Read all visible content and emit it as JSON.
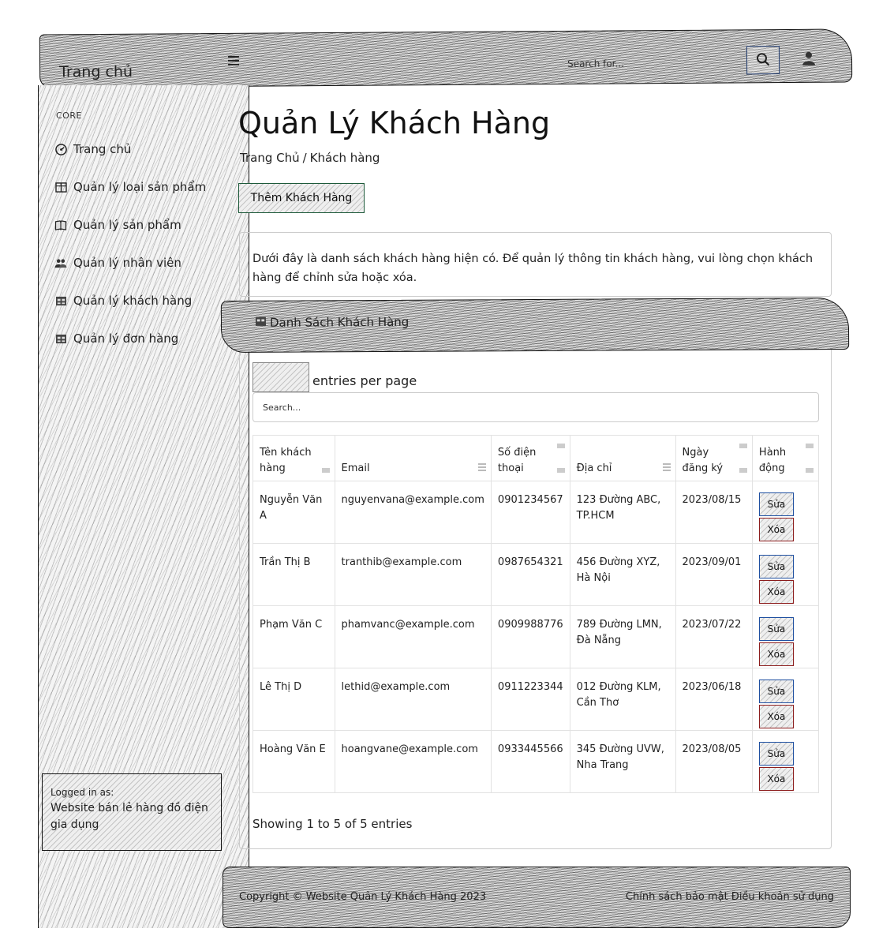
{
  "navbar": {
    "brand": "Trang chủ",
    "search_placeholder": "Search for...",
    "icons": {
      "toggle": "menu-icon",
      "search": "search-icon",
      "user": "user-icon"
    }
  },
  "sidebar": {
    "heading": "CORE",
    "items": [
      {
        "label": "Trang chủ",
        "icon": "dashboard-icon"
      },
      {
        "label": "Quản lý loại sản phẩm",
        "icon": "columns-icon"
      },
      {
        "label": "Quản lý sản phẩm",
        "icon": "book-icon"
      },
      {
        "label": "Quản lý nhân viên",
        "icon": "users-icon"
      },
      {
        "label": "Quản lý khách hàng",
        "icon": "table-icon"
      },
      {
        "label": "Quản lý đơn hàng",
        "icon": "table-icon"
      }
    ],
    "footer": {
      "logged_in_label": "Logged in as:",
      "user": "Website bán lẻ hàng đồ điện gia dụng"
    }
  },
  "page": {
    "title": "Quản Lý Khách Hàng",
    "breadcrumb": [
      "Trang Chủ",
      "Khách hàng"
    ],
    "breadcrumb_sep": "/",
    "add_button": "Thêm Khách Hàng",
    "description": "Dưới đây là danh sách khách hàng hiện có. Để quản lý thông tin khách hàng, vui lòng chọn khách hàng để chỉnh sửa hoặc xóa."
  },
  "table_card": {
    "header": "Danh Sách Khách Hàng",
    "entries_label": "entries per page",
    "search_placeholder": "Search...",
    "columns": [
      "Tên khách hàng",
      "Email",
      "Số điện thoại",
      "Địa chỉ",
      "Ngày đăng ký",
      "Hành động"
    ],
    "rows": [
      {
        "name": "Nguyễn Văn A",
        "email": "nguyenvana@example.com",
        "phone": "0901234567",
        "address": "123 Đường ABC, TP.HCM",
        "date": "2023/08/15"
      },
      {
        "name": "Trần Thị B",
        "email": "tranthib@example.com",
        "phone": "0987654321",
        "address": "456 Đường XYZ, Hà Nội",
        "date": "2023/09/01"
      },
      {
        "name": "Phạm Văn C",
        "email": "phamvanc@example.com",
        "phone": "0909988776",
        "address": "789 Đường LMN, Đà Nẵng",
        "date": "2023/07/22"
      },
      {
        "name": "Lê Thị D",
        "email": "lethid@example.com",
        "phone": "0911223344",
        "address": "012 Đường KLM, Cần Thơ",
        "date": "2023/06/18"
      },
      {
        "name": "Hoàng Văn E",
        "email": "hoangvane@example.com",
        "phone": "0933445566",
        "address": "345 Đường UVW, Nha Trang",
        "date": "2023/08/05"
      }
    ],
    "edit_label": "Sửa",
    "delete_label": "Xóa",
    "showing": "Showing 1 to 5 of 5 entries"
  },
  "footer": {
    "copyright": "Copyright © Website Quản Lý Khách Hàng 2023",
    "links": [
      "Chính sách bảo mật",
      "Điều khoản sử dụng"
    ]
  }
}
